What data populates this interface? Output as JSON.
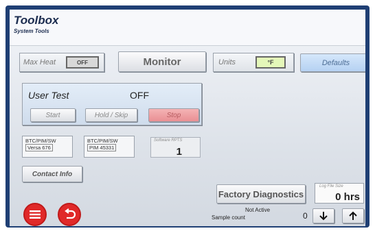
{
  "header": {
    "title": "Toolbox",
    "subtitle": "System Tools"
  },
  "max_heat": {
    "label": "Max Heat",
    "state": "OFF"
  },
  "monitor": {
    "label": "Monitor"
  },
  "units": {
    "label": "Units",
    "value": "°F"
  },
  "defaults": {
    "label": "Defaults"
  },
  "user_test": {
    "label": "User Test",
    "status": "OFF",
    "start_label": "Start",
    "hold_label": "Hold / Skip",
    "stop_label": "Stop"
  },
  "info_boxes": [
    {
      "line1": "BTC/PIM/SW",
      "line2": "Versa   676"
    },
    {
      "line1": "BTC/PIM/SW",
      "line2": "PIM 45331"
    }
  ],
  "software_rpts": {
    "caption": "Software RPTS",
    "value": "1"
  },
  "contact_info": {
    "label": "Contact Info"
  },
  "factory_diagnostics": {
    "label": "Factory Diagnostics"
  },
  "log_file": {
    "caption": "Log File Size",
    "value": "0 hrs"
  },
  "sample": {
    "status": "Not Active",
    "label": "Sample count",
    "value": "0"
  },
  "icons": {
    "menu": "menu-icon",
    "back": "back-icon",
    "down": "arrow-down-icon",
    "up": "arrow-up-icon"
  },
  "colors": {
    "frame": "#1f3f74",
    "stop": "#e98f93",
    "defaults": "#b5d1f2",
    "units_value": "#e4f7b9",
    "action_circle": "#e02929"
  }
}
